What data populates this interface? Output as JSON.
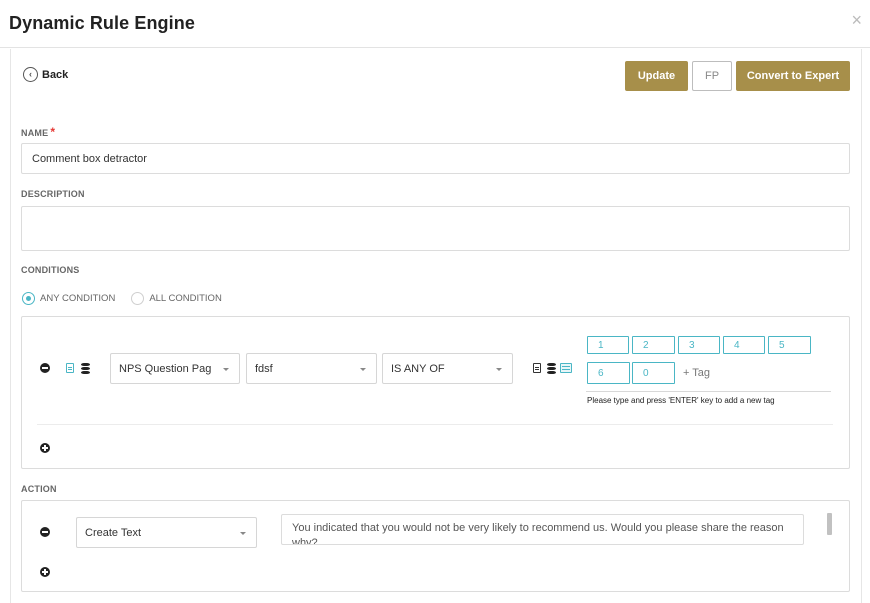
{
  "header": {
    "title": "Dynamic Rule Engine",
    "close": "×"
  },
  "toolbar": {
    "back_label": "Back",
    "back_icon": "‹",
    "update_label": "Update",
    "fp_label": "FP",
    "convert_label": "Convert to Expert"
  },
  "colors": {
    "accent": "#a78f4a",
    "teal": "#4ab6c5",
    "required": "#e53935"
  },
  "name": {
    "label": "NAME",
    "required_mark": "*",
    "value": "Comment box detractor"
  },
  "description": {
    "label": "DESCRIPTION",
    "value": ""
  },
  "conditions": {
    "label": "CONDITIONS",
    "mode_options": [
      "ANY CONDITION",
      "ALL CONDITION"
    ],
    "selected_mode": "ANY CONDITION",
    "rows": [
      {
        "field": "NPS Question Pag",
        "question": "fdsf",
        "operator": "IS ANY OF",
        "tags": [
          "1",
          "2",
          "3",
          "4",
          "5",
          "6",
          "0"
        ],
        "tag_add_label": "+ Tag",
        "tag_hint": "Please type and press 'ENTER' key to add a new tag"
      }
    ]
  },
  "action": {
    "label": "ACTION",
    "rows": [
      {
        "type": "Create Text",
        "text": "You indicated that you would not be very likely to recommend us. Would you please share the reason why?"
      }
    ]
  }
}
